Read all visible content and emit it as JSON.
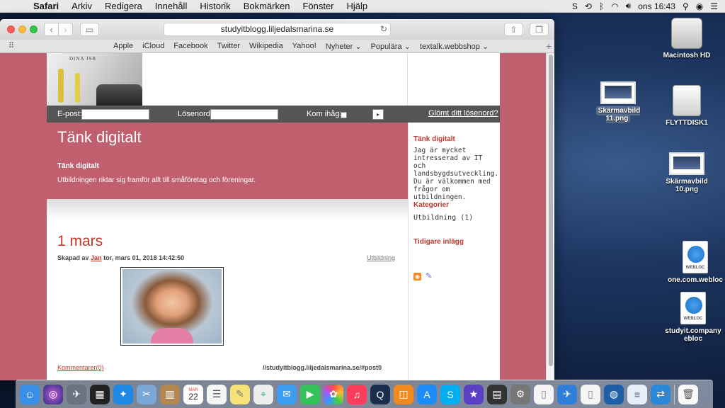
{
  "menubar": {
    "app": "Safari",
    "items": [
      "Arkiv",
      "Redigera",
      "Innehåll",
      "Historik",
      "Bokmärken",
      "Fönster",
      "Hjälp"
    ],
    "clock": "ons 16:43"
  },
  "browser": {
    "url": "studyitblogg.liljedalsmarina.se",
    "favorites": [
      "Apple",
      "iCloud",
      "Facebook",
      "Twitter",
      "Wikipedia",
      "Yahoo!",
      "Nyheter ⌄",
      "Populära ⌄",
      "textalk.webbshop ⌄"
    ]
  },
  "site": {
    "header_brand": "DINA JSR",
    "login": {
      "email_label": "E-post:",
      "password_label": "Lösenord:",
      "remember_label": "Kom ihåg:",
      "forgot_link": "Glömt ditt lösenord?"
    },
    "banner": {
      "title": "Tänk digitalt",
      "subtitle": "Tänk digitalt",
      "text": "Utbildningen riktar sig framför allt till småföretag och föreningar."
    },
    "sidebar": {
      "heading1": "Tänk digitalt",
      "text": "Jag är mycket intresserad av IT och landsbygdsutveckling. Du är välkommen med frågor om utbildningen.",
      "heading2": "Kategorier",
      "category": "Utbildning (1)",
      "heading3": "Tidigare inlägg"
    },
    "post": {
      "title": "1 mars",
      "meta_prefix": "Skapad av",
      "author": "Jan",
      "meta_date": "tor, mars 01, 2018 14:42:50",
      "category": "Utbildning",
      "comments": "Kommentarer(0)",
      "permalink": "//studyitblogg.liljedalsmarina.se/#post0"
    }
  },
  "desktop_icons": [
    {
      "label": "Macintosh HD",
      "icon": "hard-drive-icon"
    },
    {
      "label": "Skärmavbild 11.png",
      "icon": "screenshot-file-icon",
      "selected": true
    },
    {
      "label": "FLYTTDISK1",
      "icon": "usb-drive-icon"
    },
    {
      "label": "Skärmavbild 10.png",
      "icon": "screenshot-file-icon"
    },
    {
      "label": "one.com.webloc",
      "icon": "webloc-file-icon"
    },
    {
      "label": "studyit.company eblоc",
      "icon": "webloc-file-icon"
    }
  ],
  "desktop_labels": {
    "hd": "Macintosh HD",
    "shot11": "Skärmavbild 11.png",
    "usb": "FLYTTDISK1",
    "shot10": "Skärmavbild 10.png",
    "webloc1": "one.com.webloc",
    "webloc2": "studyit.company eblоc",
    "webloc_tag": "WEBLOC"
  },
  "dock": {
    "calendar_day": "22",
    "calendar_month": "MAR"
  },
  "colors": {
    "page_bg": "#c0606e",
    "accent_red": "#c0392b",
    "login_bar": "#555555"
  }
}
